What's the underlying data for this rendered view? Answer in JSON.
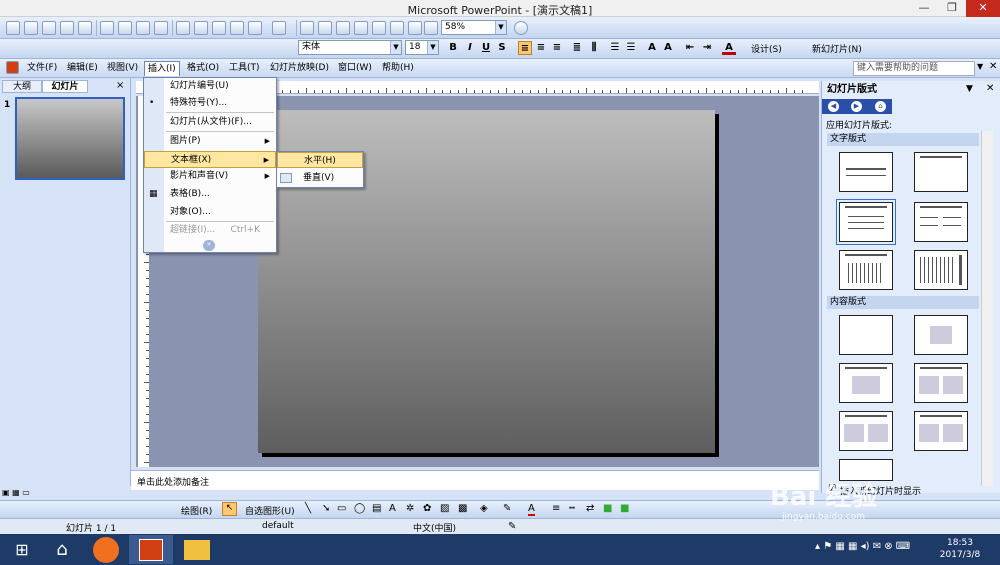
{
  "window": {
    "title": "Microsoft PowerPoint - [演示文稿1]"
  },
  "toolbar": {
    "zoom": "58%",
    "font": "宋体",
    "font_size": "18",
    "design_label": "设计(S)",
    "new_slide_label": "新幻灯片(N)"
  },
  "menus": [
    "文件(F)",
    "编辑(E)",
    "视图(V)",
    "插入(I)",
    "格式(O)",
    "工具(T)",
    "幻灯片放映(D)",
    "窗口(W)",
    "帮助(H)"
  ],
  "help_placeholder": "键入需要帮助的问题",
  "left_tabs": {
    "outline": "大纲",
    "slides": "幻灯片",
    "close": "×"
  },
  "slide_number": "1",
  "insert_menu": [
    {
      "label": "幻灯片编号(U)",
      "icon": "",
      "disabled": false,
      "submenu": false
    },
    {
      "label": "特殊符号(Y)...",
      "icon": "•",
      "disabled": false,
      "submenu": false
    },
    {
      "label": "幻灯片(从文件)(F)...",
      "icon": "",
      "disabled": false,
      "submenu": false
    },
    {
      "label": "图片(P)",
      "icon": "",
      "disabled": false,
      "submenu": true
    },
    {
      "label": "文本框(X)",
      "icon": "",
      "disabled": false,
      "submenu": true
    },
    {
      "label": "影片和声音(V)",
      "icon": "",
      "disabled": false,
      "submenu": true
    },
    {
      "label": "表格(B)...",
      "icon": "▦",
      "disabled": false,
      "submenu": false
    },
    {
      "label": "对象(O)...",
      "icon": "",
      "disabled": false,
      "submenu": false
    },
    {
      "label": "超链接(I)...",
      "shortcut": "Ctrl+K",
      "icon": "",
      "disabled": true,
      "submenu": false
    }
  ],
  "textbox_submenu": [
    "水平(H)",
    "垂直(V)"
  ],
  "notes_placeholder": "单击此处添加备注",
  "task_pane": {
    "title": "幻灯片版式",
    "apply_label": "应用幻灯片版式:",
    "text_layouts": "文字版式",
    "content_layouts": "内容版式",
    "show_when_label": "插入新幻灯片时显示"
  },
  "drawing_toolbar": {
    "draw": "绘图(R)",
    "autoshapes": "自选图形(U)"
  },
  "status": {
    "slide": "幻灯片 1 / 1",
    "design": "default",
    "language": "中文(中国)"
  },
  "clock": {
    "time": "18:53",
    "date": "2017/3/8"
  },
  "watermark": {
    "text": "Bai 经验",
    "url": "jingyan.baidu.com"
  }
}
